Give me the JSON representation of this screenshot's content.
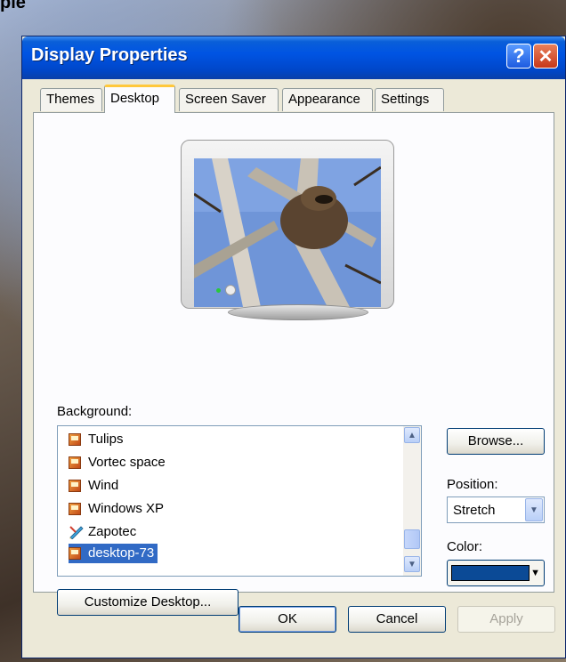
{
  "desktop": {
    "partial_text": "ple"
  },
  "window": {
    "title": "Display Properties",
    "help_glyph": "?",
    "close_glyph": "✕"
  },
  "tabs": [
    {
      "label": "Themes"
    },
    {
      "label": "Desktop",
      "active": true
    },
    {
      "label": "Screen Saver"
    },
    {
      "label": "Appearance"
    },
    {
      "label": "Settings"
    }
  ],
  "background": {
    "label": "Background:",
    "items": [
      {
        "label": "Tulips",
        "icon": "image-file-icon"
      },
      {
        "label": "Vortec space",
        "icon": "image-file-icon"
      },
      {
        "label": "Wind",
        "icon": "image-file-icon"
      },
      {
        "label": "Windows XP",
        "icon": "image-file-icon"
      },
      {
        "label": "Zapotec",
        "icon": "pen-image-icon"
      },
      {
        "label": "desktop-73",
        "icon": "image-file-icon",
        "selected": true
      }
    ]
  },
  "side": {
    "browse_label": "Browse...",
    "position_label": "Position:",
    "position_value": "Stretch",
    "color_label": "Color:",
    "color_value": "#0b4a96"
  },
  "customize_label": "Customize Desktop...",
  "footer": {
    "ok_label": "OK",
    "cancel_label": "Cancel",
    "apply_label": "Apply"
  },
  "colors": {
    "titlebar": "#0054e3",
    "selection": "#316ac5",
    "tab_highlight": "#ffc83c"
  }
}
